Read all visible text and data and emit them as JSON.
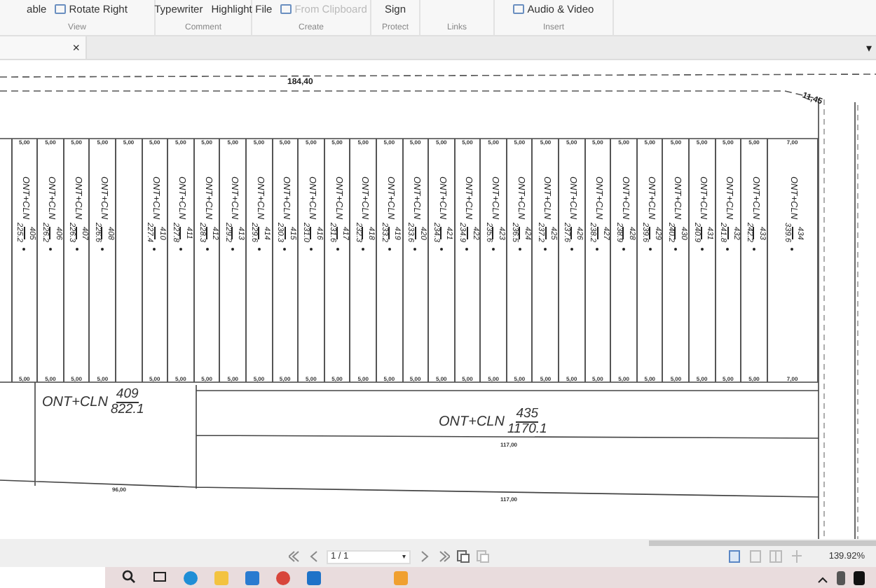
{
  "ribbon": {
    "groups": [
      {
        "label": "View",
        "items": [
          {
            "text": "able",
            "kind": "plain",
            "disabled": false
          },
          {
            "text": "Rotate Right",
            "kind": "with_icon",
            "disabled": false
          }
        ]
      },
      {
        "label": "Comment",
        "items": [
          {
            "text": "Typewriter",
            "kind": "plain",
            "disabled": false
          },
          {
            "text": "Highlight",
            "kind": "plain",
            "disabled": false
          }
        ]
      },
      {
        "label": "Create",
        "items": [
          {
            "text": "File",
            "kind": "plain",
            "disabled": false
          },
          {
            "text": "From Clipboard",
            "kind": "with_icon",
            "disabled": true
          }
        ]
      },
      {
        "label": "Protect",
        "items": [
          {
            "text": "Sign",
            "kind": "plain",
            "disabled": false
          }
        ]
      },
      {
        "label": "Links"
      },
      {
        "label": "Insert",
        "items": [
          {
            "text": "Audio & Video",
            "kind": "with_icon",
            "disabled": false
          }
        ]
      }
    ]
  },
  "tab_bar": {
    "close": "×",
    "menu": "▾"
  },
  "map": {
    "top_length": "184,40",
    "corner_length": "11,45",
    "lots": [
      {
        "kind": "cut"
      },
      {
        "kind": "lot",
        "prefix": "ONT+CLN",
        "number": "405",
        "area": "225.2",
        "top_dim": "5,00",
        "bottom_dim": "5,00"
      },
      {
        "kind": "lot",
        "prefix": "ONT+CLN",
        "number": "406",
        "area": "226.2",
        "top_dim": "5,00",
        "bottom_dim": "5,00"
      },
      {
        "kind": "lot",
        "prefix": "ONT+CLN",
        "number": "407",
        "area": "226.3",
        "top_dim": "5,00",
        "bottom_dim": "5,00"
      },
      {
        "kind": "lot",
        "prefix": "ONT+CLN",
        "number": "408",
        "area": "226.6",
        "top_dim": "5,00",
        "bottom_dim": "5,00"
      },
      {
        "kind": "blank",
        "top_dim": "5,00"
      },
      {
        "kind": "lot",
        "prefix": "ONT+CLN",
        "number": "410",
        "area": "227.4",
        "top_dim": "5,00",
        "bottom_dim": "5,00"
      },
      {
        "kind": "lot",
        "prefix": "ONT+CLN",
        "number": "411",
        "area": "227.8",
        "top_dim": "5,00",
        "bottom_dim": "5,00"
      },
      {
        "kind": "lot",
        "prefix": "ONT+CLN",
        "number": "412",
        "area": "228.3",
        "top_dim": "5,00",
        "bottom_dim": "5,00"
      },
      {
        "kind": "lot",
        "prefix": "ONT+CLN",
        "number": "413",
        "area": "229.2",
        "top_dim": "5,00",
        "bottom_dim": "5,00"
      },
      {
        "kind": "lot",
        "prefix": "ONT+CLN",
        "number": "414",
        "area": "229.6",
        "top_dim": "5,00",
        "bottom_dim": "5,00"
      },
      {
        "kind": "lot",
        "prefix": "ONT+CLN",
        "number": "415",
        "area": "230.3",
        "top_dim": "5,00",
        "bottom_dim": "5,00"
      },
      {
        "kind": "lot",
        "prefix": "ONT+CLN",
        "number": "416",
        "area": "231.0",
        "top_dim": "5,00",
        "bottom_dim": "5,00"
      },
      {
        "kind": "lot",
        "prefix": "ONT+CLN",
        "number": "417",
        "area": "231.6",
        "top_dim": "5,00",
        "bottom_dim": "5,00"
      },
      {
        "kind": "lot",
        "prefix": "ONT+CLN",
        "number": "418",
        "area": "232.3",
        "top_dim": "5,00",
        "bottom_dim": "5,00"
      },
      {
        "kind": "lot",
        "prefix": "ONT+CLN",
        "number": "419",
        "area": "233.2",
        "top_dim": "5,00",
        "bottom_dim": "5,00"
      },
      {
        "kind": "lot",
        "prefix": "ONT+CLN",
        "number": "420",
        "area": "233.6",
        "top_dim": "5,00",
        "bottom_dim": "5,00"
      },
      {
        "kind": "lot",
        "prefix": "ONT+CLN",
        "number": "421",
        "area": "234.3",
        "top_dim": "5,00",
        "bottom_dim": "5,00"
      },
      {
        "kind": "lot",
        "prefix": "ONT+CLN",
        "number": "422",
        "area": "234.9",
        "top_dim": "5,00",
        "bottom_dim": "5,00"
      },
      {
        "kind": "lot",
        "prefix": "ONT+CLN",
        "number": "423",
        "area": "235.6",
        "top_dim": "5,00",
        "bottom_dim": "5,00"
      },
      {
        "kind": "lot",
        "prefix": "ONT+CLN",
        "number": "424",
        "area": "236.5",
        "top_dim": "5,00",
        "bottom_dim": "5,00"
      },
      {
        "kind": "lot",
        "prefix": "ONT+CLN",
        "number": "425",
        "area": "237.2",
        "top_dim": "5,00",
        "bottom_dim": "5,00"
      },
      {
        "kind": "lot",
        "prefix": "ONT+CLN",
        "number": "426",
        "area": "237.6",
        "top_dim": "5,00",
        "bottom_dim": "5,00"
      },
      {
        "kind": "lot",
        "prefix": "ONT+CLN",
        "number": "427",
        "area": "238.2",
        "top_dim": "5,00",
        "bottom_dim": "5,00"
      },
      {
        "kind": "lot",
        "prefix": "ONT+CLN",
        "number": "428",
        "area": "238.9",
        "top_dim": "5,00",
        "bottom_dim": "5,00"
      },
      {
        "kind": "lot",
        "prefix": "ONT+CLN",
        "number": "429",
        "area": "239.6",
        "top_dim": "5,00",
        "bottom_dim": "5,00"
      },
      {
        "kind": "lot",
        "prefix": "ONT+CLN",
        "number": "430",
        "area": "240.2",
        "top_dim": "5,00",
        "bottom_dim": "5,00"
      },
      {
        "kind": "lot",
        "prefix": "ONT+CLN",
        "number": "431",
        "area": "240.9",
        "top_dim": "5,00",
        "bottom_dim": "5,00"
      },
      {
        "kind": "lot",
        "prefix": "ONT+CLN",
        "number": "432",
        "area": "241.8",
        "top_dim": "5,00",
        "bottom_dim": "5,00"
      },
      {
        "kind": "lot",
        "prefix": "ONT+CLN",
        "number": "433",
        "area": "242.2",
        "top_dim": "5,00",
        "bottom_dim": "5,00"
      },
      {
        "kind": "lot",
        "prefix": "ONT+CLN",
        "number": "434",
        "area": "339.6",
        "top_dim": "7,00",
        "bottom_dim": "7,00"
      }
    ],
    "lot_409": {
      "prefix": "ONT+CLN",
      "number": "409",
      "area": "822.1",
      "bottom_dim": "96,00"
    },
    "lot_435": {
      "prefix": "ONT+CLN",
      "number": "435",
      "area": "1170.1",
      "middle_dim": "117,00",
      "bottom_dim": "117,00"
    }
  },
  "nav_bar": {
    "page": "1 / 1",
    "page_menu": "▾",
    "zoom": "139.92%"
  }
}
